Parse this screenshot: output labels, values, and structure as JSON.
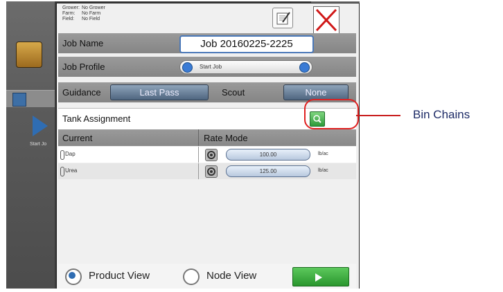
{
  "info": {
    "grower_label": "Grower:",
    "grower_value": "No Grower",
    "farm_label": "Farm:",
    "farm_value": "No Farm",
    "field_label": "Field:",
    "field_value": "No Field"
  },
  "job_name": {
    "label": "Job Name",
    "value": "Job 20160225-2225"
  },
  "job_profile": {
    "label": "Job Profile",
    "value": "Start Job"
  },
  "guidance": {
    "label": "Guidance",
    "value": "Last Pass"
  },
  "scout": {
    "label": "Scout",
    "value": "None"
  },
  "tank": {
    "label": "Tank Assignment"
  },
  "table": {
    "col_current": "Current",
    "col_rate": "Rate Mode",
    "rows": [
      {
        "product": "Dap",
        "rate": "100.00",
        "unit": "lb/ac"
      },
      {
        "product": "Urea",
        "rate": "125.00",
        "unit": "lb/ac"
      }
    ]
  },
  "view": {
    "product_view": "Product View",
    "node_view": "Node View",
    "selected": "Product View"
  },
  "background": {
    "start_job_label": "Start Jo"
  },
  "callout": {
    "label": "Bin Chains"
  },
  "colors": {
    "accent": "#2f6db3",
    "go_green": "#2a962e",
    "callout_red": "#e02020"
  },
  "icons": [
    "edit-icon",
    "close-icon",
    "filter-icon",
    "play-icon",
    "search-icon",
    "target-icon",
    "product-icon",
    "arrow-right-icon"
  ]
}
